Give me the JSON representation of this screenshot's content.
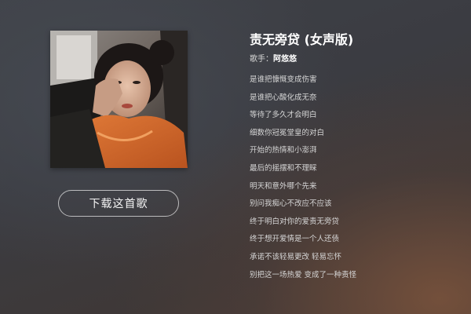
{
  "song": {
    "title": "责无旁贷 (女声版)",
    "singer_label": "歌手：",
    "singer_name": "阿悠悠"
  },
  "actions": {
    "download_label": "下载这首歌"
  },
  "lyrics": [
    "是谁把慷慨变成伤害",
    "是谁把心酸化成无奈",
    "等待了多久才会明白",
    "细数你冠冕堂皇的对白",
    "开始的热情和小澎湃",
    "最后的摇摆和不理睬",
    "明天和意外哪个先来",
    "别问我痴心不改应不应该",
    "终于明白对你的爱责无旁贷",
    "终于想开爱情是一个人还债",
    "承诺不该轻易更改 轻易忘怀",
    "别把这一场热爱 变成了一种责怪"
  ],
  "colors": {
    "text_primary": "#ffffff",
    "text_secondary": "#d6d6d6",
    "button_border": "#e6e6e6"
  }
}
